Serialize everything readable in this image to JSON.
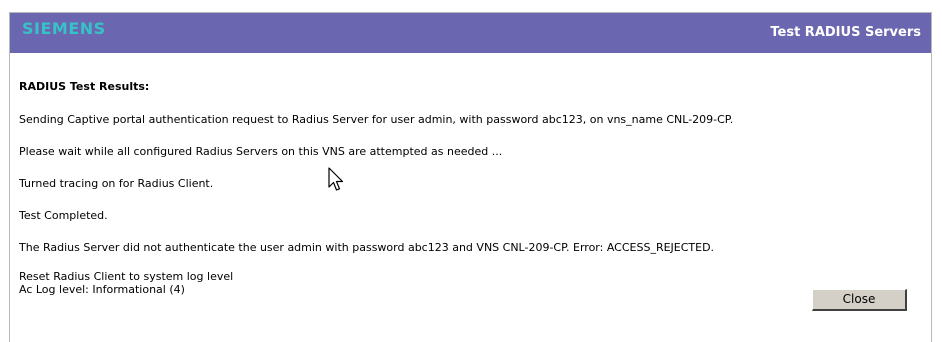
{
  "header": {
    "logo_text": "SIEMENS",
    "title": "Test RADIUS Servers"
  },
  "results": {
    "heading": "RADIUS Test Results:",
    "lines": [
      "Sending Captive portal authentication request to Radius Server for user admin, with password abc123, on vns_name CNL-209-CP.",
      "Please wait while all configured Radius Servers on this VNS are attempted as needed ...",
      "Turned tracing on for Radius Client.",
      "Test Completed.",
      "The Radius Server did not authenticate the user admin with password abc123 and VNS CNL-209-CP. Error: ACCESS_REJECTED.",
      "Reset Radius Client to system log level",
      "Ac Log level: Informational (4)"
    ]
  },
  "actions": {
    "close_label": "Close"
  },
  "icons": {
    "cursor": "mouse-pointer-icon"
  },
  "colors": {
    "header_bg": "#6b66b0",
    "logo": "#37c2c8",
    "title": "#ffffff"
  }
}
